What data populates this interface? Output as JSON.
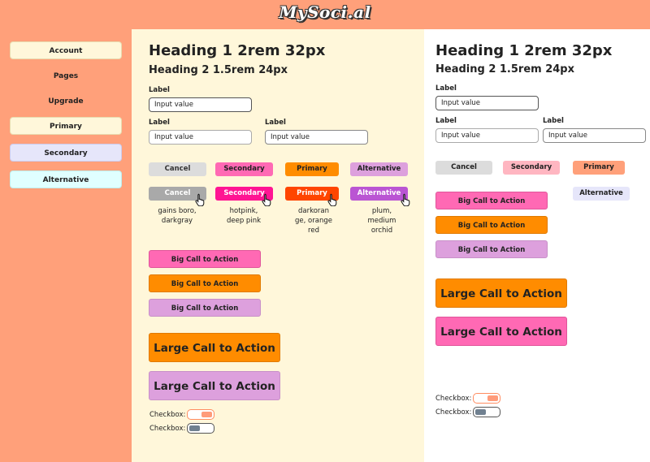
{
  "header": {
    "logo": "MySoci.al"
  },
  "sidebar": {
    "items": [
      {
        "label": "Account"
      },
      {
        "label": "Pages"
      },
      {
        "label": "Upgrade"
      },
      {
        "label": "Primary"
      },
      {
        "label": "Secondary"
      },
      {
        "label": "Alternative"
      }
    ]
  },
  "left_panel": {
    "h1": "Heading 1 2rem 32px",
    "h2": "Heading 2 1.5rem 24px",
    "field1": {
      "label": "Label",
      "value": "Input value"
    },
    "field2": {
      "label": "Label",
      "value": "Input value"
    },
    "field3": {
      "label": "Label",
      "value": "Input value"
    },
    "buttons": {
      "cancel": "Cancel",
      "secondary": "Secondary",
      "primary": "Primary",
      "alternative": "Alternative"
    },
    "hover_buttons": {
      "cancel": "Cancel",
      "secondary": "Secondary",
      "primary": "Primary",
      "alternative": "Alternative"
    },
    "captions": {
      "cancel": [
        "gains boro,",
        "darkgray"
      ],
      "secondary": [
        "hotpink,",
        "deep pink"
      ],
      "primary": [
        "darkoran",
        "ge, orange",
        "red"
      ],
      "alternative": [
        "plum,",
        "medium",
        "orchid"
      ]
    },
    "big_cta": [
      "Big Call to Action",
      "Big Call to Action",
      "Big Call to Action"
    ],
    "large_cta": [
      "Large Call to Action",
      "Large Call to Action"
    ],
    "checkboxes": [
      "Checkbox:",
      "Checkbox:"
    ]
  },
  "right_panel": {
    "h1": "Heading 1 2rem 32px",
    "h2": "Heading 2 1.5rem 24px",
    "field1": {
      "label": "Label",
      "value": "Input value"
    },
    "field2": {
      "label": "Label",
      "value": "Input value"
    },
    "field3": {
      "label": "Label",
      "value": "Input value"
    },
    "buttons": {
      "cancel": "Cancel",
      "secondary": "Secondary",
      "primary": "Primary",
      "alternative": "Alternative"
    },
    "big_cta": [
      "Big Call to Action",
      "Big Call to Action",
      "Big Call to Action"
    ],
    "large_cta": [
      "Large Call to Action",
      "Large Call to Action"
    ],
    "checkboxes": [
      "Checkbox:",
      "Checkbox:"
    ]
  },
  "colors": {
    "background": "#FFA07A",
    "cream": "#FFF7DA",
    "gainsboro": "#DCDCDC",
    "darkgray": "#A9A9A9",
    "hotpink": "#FF69B4",
    "deeppink": "#FF1493",
    "darkorange": "#FF8C00",
    "orangered": "#FF4500",
    "plum": "#DDA0DD",
    "mediumorchid": "#BA55D3"
  },
  "icons": {
    "cursor": "hand-pointer-icon"
  }
}
